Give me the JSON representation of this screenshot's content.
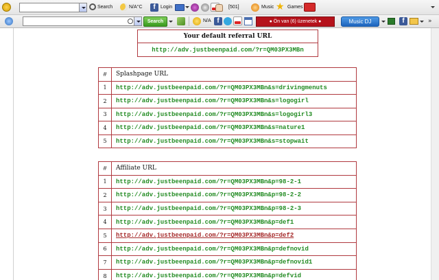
{
  "toolbar1": {
    "search_label": "Search",
    "weather_label": "N/A°C",
    "login_label": "Login",
    "counter_label": "[501]",
    "music_label": "Music",
    "games_label": "Games"
  },
  "toolbar2": {
    "search_button": "Search",
    "weather_label": "N/A",
    "notification_label": "● Ön van (6) üzenetek ●",
    "music_dj_label": "Music DJ"
  },
  "referral": {
    "heading": "Your default referral URL",
    "url": "http://adv.justbeenpaid.com/?r=QM03PX3MBn"
  },
  "splash_table": {
    "num_header": "#",
    "title": "Splashpage URL",
    "rows": [
      {
        "num": "1",
        "url": "http://adv.justbeenpaid.com/?r=QM03PX3MBn&s=drivingmenuts"
      },
      {
        "num": "2",
        "url": "http://adv.justbeenpaid.com/?r=QM03PX3MBn&s=logogirl"
      },
      {
        "num": "3",
        "url": "http://adv.justbeenpaid.com/?r=QM03PX3MBn&s=logogirl3"
      },
      {
        "num": "4",
        "url": "http://adv.justbeenpaid.com/?r=QM03PX3MBn&s=nature1"
      },
      {
        "num": "5",
        "url": "http://adv.justbeenpaid.com/?r=QM03PX3MBn&s=stopwait"
      }
    ]
  },
  "affiliate_table": {
    "num_header": "#",
    "title": "Affiliate URL",
    "rows": [
      {
        "num": "1",
        "url": "http://adv.justbeenpaid.com/?r=QM03PX3MBn&p=98-2-1"
      },
      {
        "num": "2",
        "url": "http://adv.justbeenpaid.com/?r=QM03PX3MBn&p=98-2-2"
      },
      {
        "num": "3",
        "url": "http://adv.justbeenpaid.com/?r=QM03PX3MBn&p=98-2-3"
      },
      {
        "num": "4",
        "url": "http://adv.justbeenpaid.com/?r=QM03PX3MBn&p=def1"
      },
      {
        "num": "5",
        "url": "http://adv.justbeenpaid.com/?r=QM03PX3MBn&p=def2"
      },
      {
        "num": "6",
        "url": "http://adv.justbeenpaid.com/?r=QM03PX3MBn&p=defnovid"
      },
      {
        "num": "7",
        "url": "http://adv.justbeenpaid.com/?r=QM03PX3MBn&p=defnovid1"
      },
      {
        "num": "8",
        "url": "http://adv.justbeenpaid.com/?r=QM03PX3MBn&p=defvid"
      }
    ]
  },
  "colors": {
    "link_green": "#228b22",
    "link_hover": "#a52a2a",
    "table_border": "#b0383e"
  }
}
